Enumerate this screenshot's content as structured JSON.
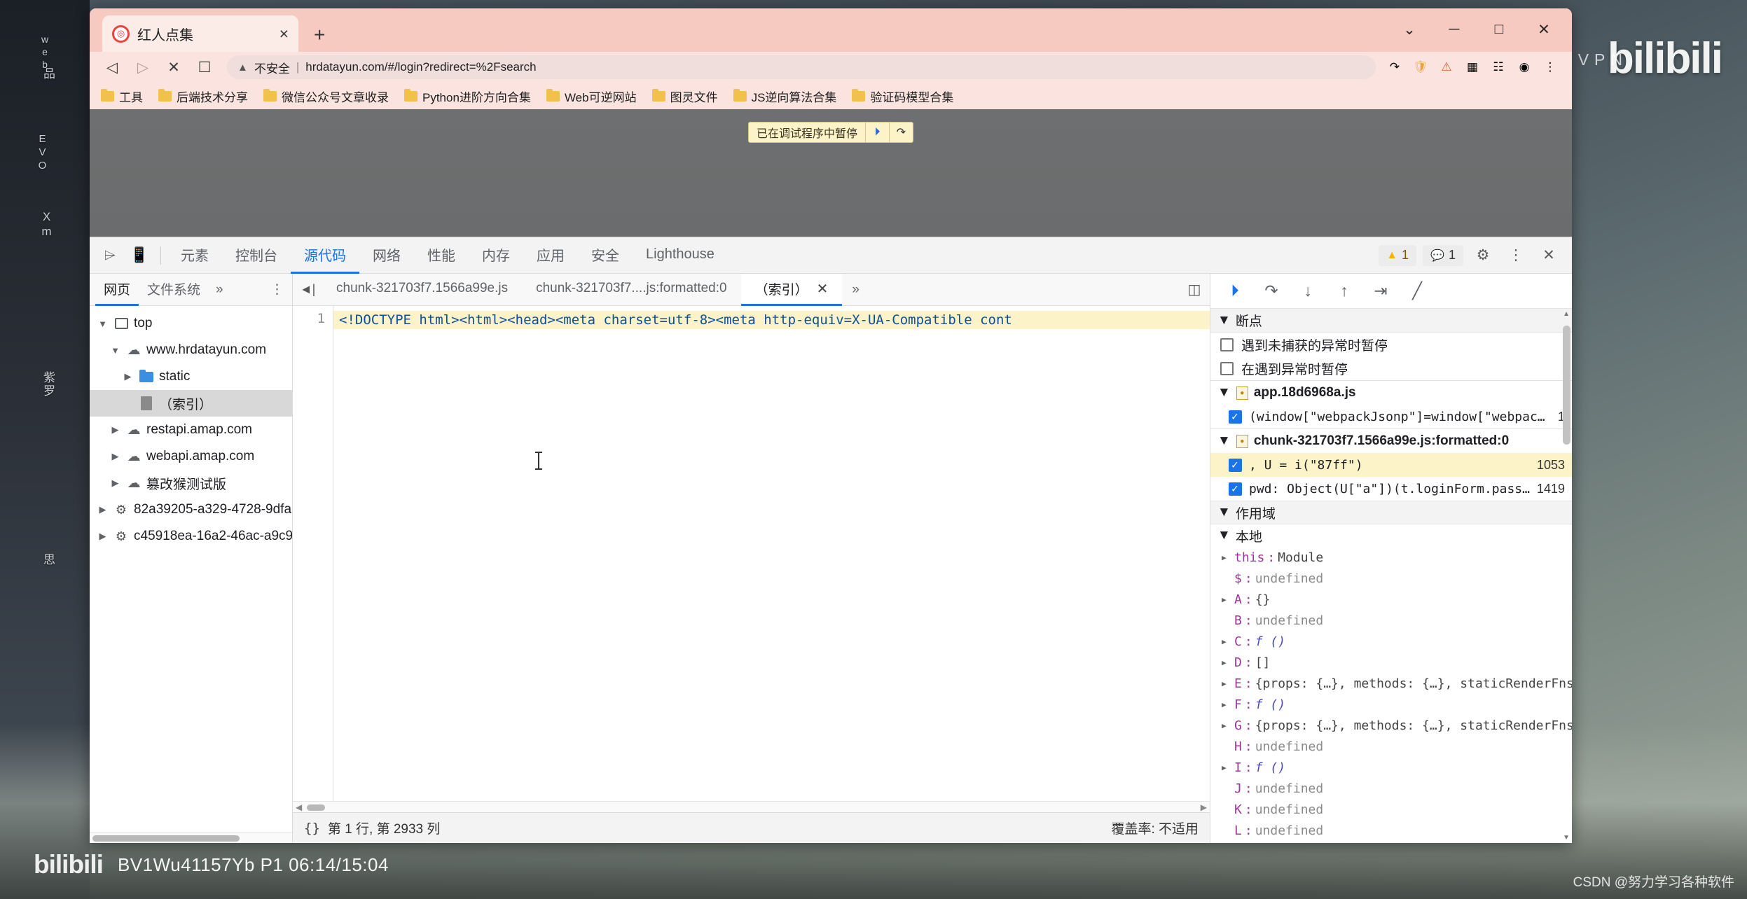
{
  "desktop": {
    "icons": [
      "web",
      "品",
      "EVO",
      "Xm",
      "紫罗",
      "思"
    ],
    "bilibili_logo": "bilibili",
    "bilibili_sub": "VPN",
    "bottom_logo": "bilibili",
    "bottom_text": "BV1Wu41157Yb P1 06:14/15:04",
    "csdn_watermark": "CSDN @努力学习各种软件"
  },
  "browser": {
    "tab": {
      "title": "红人点集",
      "favicon": "hongren-favicon",
      "close_label": "×"
    },
    "new_tab_label": "+",
    "window_controls": {
      "minimize": "─",
      "maximize": "□",
      "close": "✕",
      "more": "⌄"
    },
    "toolbar": {
      "back": "◁",
      "forward": "▷",
      "stop": "✕",
      "bookmark": "☐",
      "security_label": "不安全",
      "url": "hrdatayun.com/#/login?redirect=%2Fsearch",
      "right_icons": [
        "share-icon",
        "shield-icon",
        "warning-icon",
        "extension-icon",
        "puzzle-icon",
        "profile-icon",
        "menu-icon"
      ]
    },
    "bookmarks": [
      {
        "label": "工具"
      },
      {
        "label": "后端技术分享"
      },
      {
        "label": "微信公众号文章收录"
      },
      {
        "label": "Python进阶方向合集"
      },
      {
        "label": "Web可逆网站"
      },
      {
        "label": "图灵文件"
      },
      {
        "label": "JS逆向算法合集"
      },
      {
        "label": "验证码模型合集"
      }
    ],
    "pause_banner": {
      "text": "已在调试程序中暂停",
      "resume_label": "⏵",
      "step_label": "↷"
    }
  },
  "devtools": {
    "inspect_icon": "inspect-cursor-icon",
    "device_icon": "device-toolbar-icon",
    "tabs": [
      {
        "label": "元素",
        "active": false
      },
      {
        "label": "控制台",
        "active": false
      },
      {
        "label": "源代码",
        "active": true
      },
      {
        "label": "网络",
        "active": false
      },
      {
        "label": "性能",
        "active": false
      },
      {
        "label": "内存",
        "active": false
      },
      {
        "label": "应用",
        "active": false
      },
      {
        "label": "安全",
        "active": false
      },
      {
        "label": "Lighthouse",
        "active": false
      }
    ],
    "warning_count": "1",
    "message_count": "1",
    "settings_icon": "gear-icon",
    "more_icon": "kebab-menu-icon",
    "close_icon": "close-icon",
    "navigator": {
      "tabs": [
        {
          "label": "网页",
          "active": true
        },
        {
          "label": "文件系统",
          "active": false
        }
      ],
      "more_label": "»",
      "dots_label": "⋮",
      "tree": [
        {
          "label": "top",
          "icon": "frame-icon",
          "indent": 0,
          "toggle": "open",
          "selected": false
        },
        {
          "label": "www.hrdatayun.com",
          "icon": "cloud-icon",
          "indent": 1,
          "toggle": "open",
          "selected": false
        },
        {
          "label": "static",
          "icon": "folder-icon",
          "indent": 2,
          "toggle": "closed",
          "selected": false
        },
        {
          "label": "（索引）",
          "icon": "doc-icon",
          "indent": 2,
          "toggle": "none",
          "selected": true
        },
        {
          "label": "restapi.amap.com",
          "icon": "cloud-icon",
          "indent": 1,
          "toggle": "closed",
          "selected": false
        },
        {
          "label": "webapi.amap.com",
          "icon": "cloud-icon",
          "indent": 1,
          "toggle": "closed",
          "selected": false
        },
        {
          "label": "篡改猴测试版",
          "icon": "cloud-icon",
          "indent": 1,
          "toggle": "closed",
          "selected": false
        },
        {
          "label": "82a39205-a329-4728-9dfa",
          "icon": "gear-icon",
          "indent": 0,
          "toggle": "closed",
          "selected": false
        },
        {
          "label": "c45918ea-16a2-46ac-a9c9",
          "icon": "gear-icon",
          "indent": 0,
          "toggle": "closed",
          "selected": false
        }
      ]
    },
    "editor": {
      "collapse_icon": "collapse-sidebar-icon",
      "tabs": [
        {
          "label": "chunk-321703f7.1566a99e.js",
          "active": false,
          "closable": false
        },
        {
          "label": "chunk-321703f7....js:formatted:0",
          "active": false,
          "closable": false
        },
        {
          "label": "（索引）",
          "active": true,
          "closable": true
        }
      ],
      "more_label": "»",
      "right_icon": "show-navigator-icon",
      "line_number": "1",
      "code_line": "<!DOCTYPE html><html><head><meta charset=utf-8><meta http-equiv=X-UA-Compatible cont",
      "status": {
        "braces": "{}",
        "position": "第 1 行, 第 2933 列",
        "coverage": "覆盖率: 不适用"
      }
    },
    "debugger": {
      "controls": [
        "resume-button",
        "step-over-button",
        "step-into-button",
        "step-out-button",
        "step-button",
        "deactivate-breakpoints-button"
      ],
      "control_glyphs": [
        "⏵",
        "↷",
        "↓",
        "↑",
        "⇥",
        "╱"
      ],
      "breakpoints_section": "断点",
      "pause_options": [
        {
          "label": "遇到未捕获的异常时暂停",
          "checked": false
        },
        {
          "label": "在遇到异常时暂停",
          "checked": false
        }
      ],
      "breakpoint_groups": [
        {
          "file": "app.18d6968a.js",
          "items": [
            {
              "text": "(window[\"webpackJsonp\"]=window[\"webpac…",
              "line": "1",
              "checked": true,
              "highlighted": false
            }
          ]
        },
        {
          "file": "chunk-321703f7.1566a99e.js:formatted:0",
          "items": [
            {
              "text": ", U = i(\"87ff\")",
              "line": "1053",
              "checked": true,
              "highlighted": true
            },
            {
              "text": "pwd: Object(U[\"a\"])(t.loginForm.pass…",
              "line": "1419",
              "checked": true,
              "highlighted": false
            }
          ]
        }
      ],
      "scope_label": "作用域",
      "scope_local_label": "本地",
      "variables": [
        {
          "name": "this",
          "value": "Module",
          "expandable": true,
          "kind": "obj"
        },
        {
          "name": "$",
          "value": "undefined",
          "expandable": false,
          "kind": "undef"
        },
        {
          "name": "A",
          "value": "{}",
          "expandable": true,
          "kind": "obj"
        },
        {
          "name": "B",
          "value": "undefined",
          "expandable": false,
          "kind": "undef"
        },
        {
          "name": "C",
          "value": "f ()",
          "expandable": true,
          "kind": "fn"
        },
        {
          "name": "D",
          "value": "[]",
          "expandable": true,
          "kind": "obj"
        },
        {
          "name": "E",
          "value": "{props: {…}, methods: {…}, staticRenderFns:",
          "expandable": true,
          "kind": "obj"
        },
        {
          "name": "F",
          "value": "f ()",
          "expandable": true,
          "kind": "fn"
        },
        {
          "name": "G",
          "value": "{props: {…}, methods: {…}, staticRenderFns:",
          "expandable": true,
          "kind": "obj"
        },
        {
          "name": "H",
          "value": "undefined",
          "expandable": false,
          "kind": "undef"
        },
        {
          "name": "I",
          "value": "f ()",
          "expandable": true,
          "kind": "fn"
        },
        {
          "name": "J",
          "value": "undefined",
          "expandable": false,
          "kind": "undef"
        },
        {
          "name": "K",
          "value": "undefined",
          "expandable": false,
          "kind": "undef"
        },
        {
          "name": "L",
          "value": "undefined",
          "expandable": false,
          "kind": "undef"
        }
      ]
    }
  }
}
